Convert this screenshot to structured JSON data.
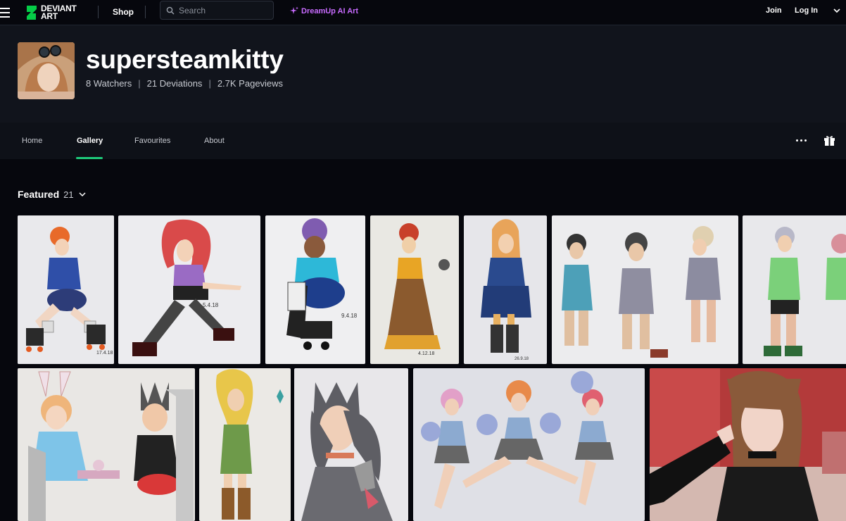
{
  "topbar": {
    "logo_text_1": "DEVIANT",
    "logo_text_2": "ART",
    "shop": "Shop",
    "search_placeholder": "Search",
    "dreamup": "DreamUp AI Art",
    "join": "Join",
    "login": "Log In",
    "brand_green": "#05cc47",
    "dreamup_color": "#c86bff"
  },
  "profile": {
    "username": "supersteamkitty",
    "watchers": "8 Watchers",
    "deviations": "21 Deviations",
    "pageviews": "2.7K Pageviews"
  },
  "nav": {
    "tabs": [
      "Home",
      "Gallery",
      "Favourites",
      "About"
    ],
    "active": "Gallery",
    "accent": "#1ec97a"
  },
  "gallery": {
    "section_title": "Featured",
    "count": "21",
    "row1": [
      {
        "name": "roller-derby-girl-blue",
        "date": "17.4.18"
      },
      {
        "name": "roller-derby-girl-red-hair",
        "date": "5.4.18"
      },
      {
        "name": "roller-derby-girl-purple-hair",
        "date": "9.4.18"
      },
      {
        "name": "victorian-dress-girl",
        "date": "4.12.18"
      },
      {
        "name": "blue-military-coat-girl",
        "date": "26.9.18"
      },
      {
        "name": "three-roller-derby-girls",
        "date": ""
      },
      {
        "name": "roller-derby-duo",
        "date": ""
      }
    ],
    "row2": [
      {
        "name": "tea-party-bunny-and-cat",
        "date": ""
      },
      {
        "name": "green-dress-blonde-girl",
        "date": ""
      },
      {
        "name": "cat-ear-girl-grey",
        "date": ""
      },
      {
        "name": "three-cheerleaders",
        "date": ""
      },
      {
        "name": "cosplay-photo",
        "date": ""
      }
    ]
  }
}
